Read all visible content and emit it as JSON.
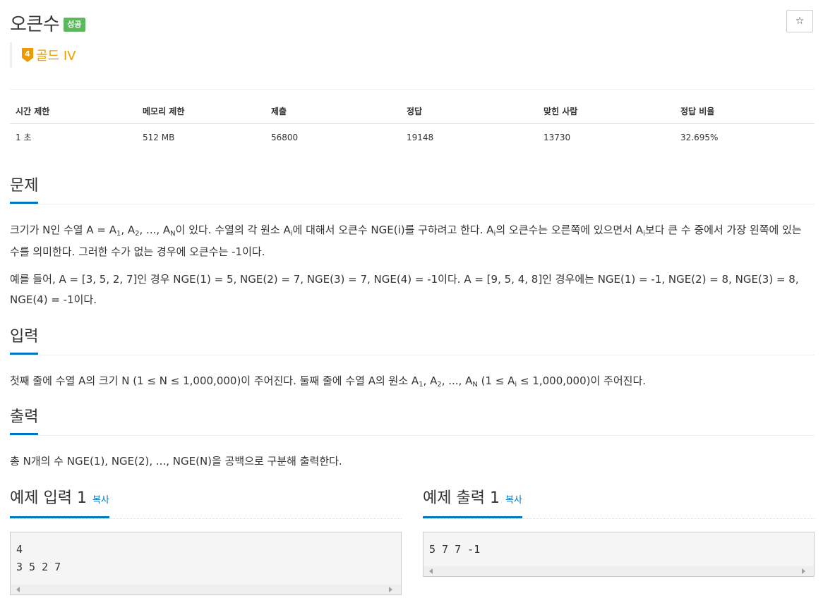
{
  "problem": {
    "title": "오큰수",
    "status_badge": "성공",
    "star_symbol": "☆",
    "tier_number": "4",
    "tier_label": "골드 IV"
  },
  "info_table": {
    "headers": [
      "시간 제한",
      "메모리 제한",
      "제출",
      "정답",
      "맞힌 사람",
      "정답 비율"
    ],
    "values": [
      "1 초",
      "512 MB",
      "56800",
      "19148",
      "13730",
      "32.695%"
    ]
  },
  "sections": {
    "problem_heading": "문제",
    "problem_p1_a": "크기가 N인 수열 A = A",
    "problem_p1_sub1": "1",
    "problem_p1_b": ", A",
    "problem_p1_sub2": "2",
    "problem_p1_c": ", ..., A",
    "problem_p1_subN": "N",
    "problem_p1_d": "이 있다. 수열의 각 원소 A",
    "problem_p1_subi1": "i",
    "problem_p1_e": "에 대해서 오큰수 NGE(i)를 구하려고 한다. A",
    "problem_p1_subi2": "i",
    "problem_p1_f": "의 오큰수는 오른쪽에 있으면서 A",
    "problem_p1_subi3": "i",
    "problem_p1_g": "보다 큰 수 중에서 가장 왼쪽에 있는 수를 의미한다. 그러한 수가 없는 경우에 오큰수는 -1이다.",
    "problem_p2": "예를 들어, A = [3, 5, 2, 7]인 경우 NGE(1) = 5, NGE(2) = 7, NGE(3) = 7, NGE(4) = -1이다. A = [9, 5, 4, 8]인 경우에는 NGE(1) = -1, NGE(2) = 8, NGE(3) = 8, NGE(4) = -1이다.",
    "input_heading": "입력",
    "input_a": "첫째 줄에 수열 A의 크기 N (1 ≤ N ≤ 1,000,000)이 주어진다. 둘째 줄에 수열 A의 원소 A",
    "input_sub1": "1",
    "input_b": ", A",
    "input_sub2": "2",
    "input_c": ", ..., A",
    "input_subN": "N",
    "input_d": " (1 ≤ A",
    "input_subi": "i",
    "input_e": " ≤ 1,000,000)이 주어진다.",
    "output_heading": "출력",
    "output_text": "총 N개의 수 NGE(1), NGE(2), ..., NGE(N)을 공백으로 구분해 출력한다."
  },
  "samples": {
    "input_heading": "예제 입력 1",
    "output_heading": "예제 출력 1",
    "copy_label": "복사",
    "input_text": "4\n3 5 2 7",
    "output_text": "5 7 7 -1"
  },
  "colors": {
    "accent": "#0076c0",
    "badge": "#5cb85c",
    "tier": "#ec9a00"
  }
}
